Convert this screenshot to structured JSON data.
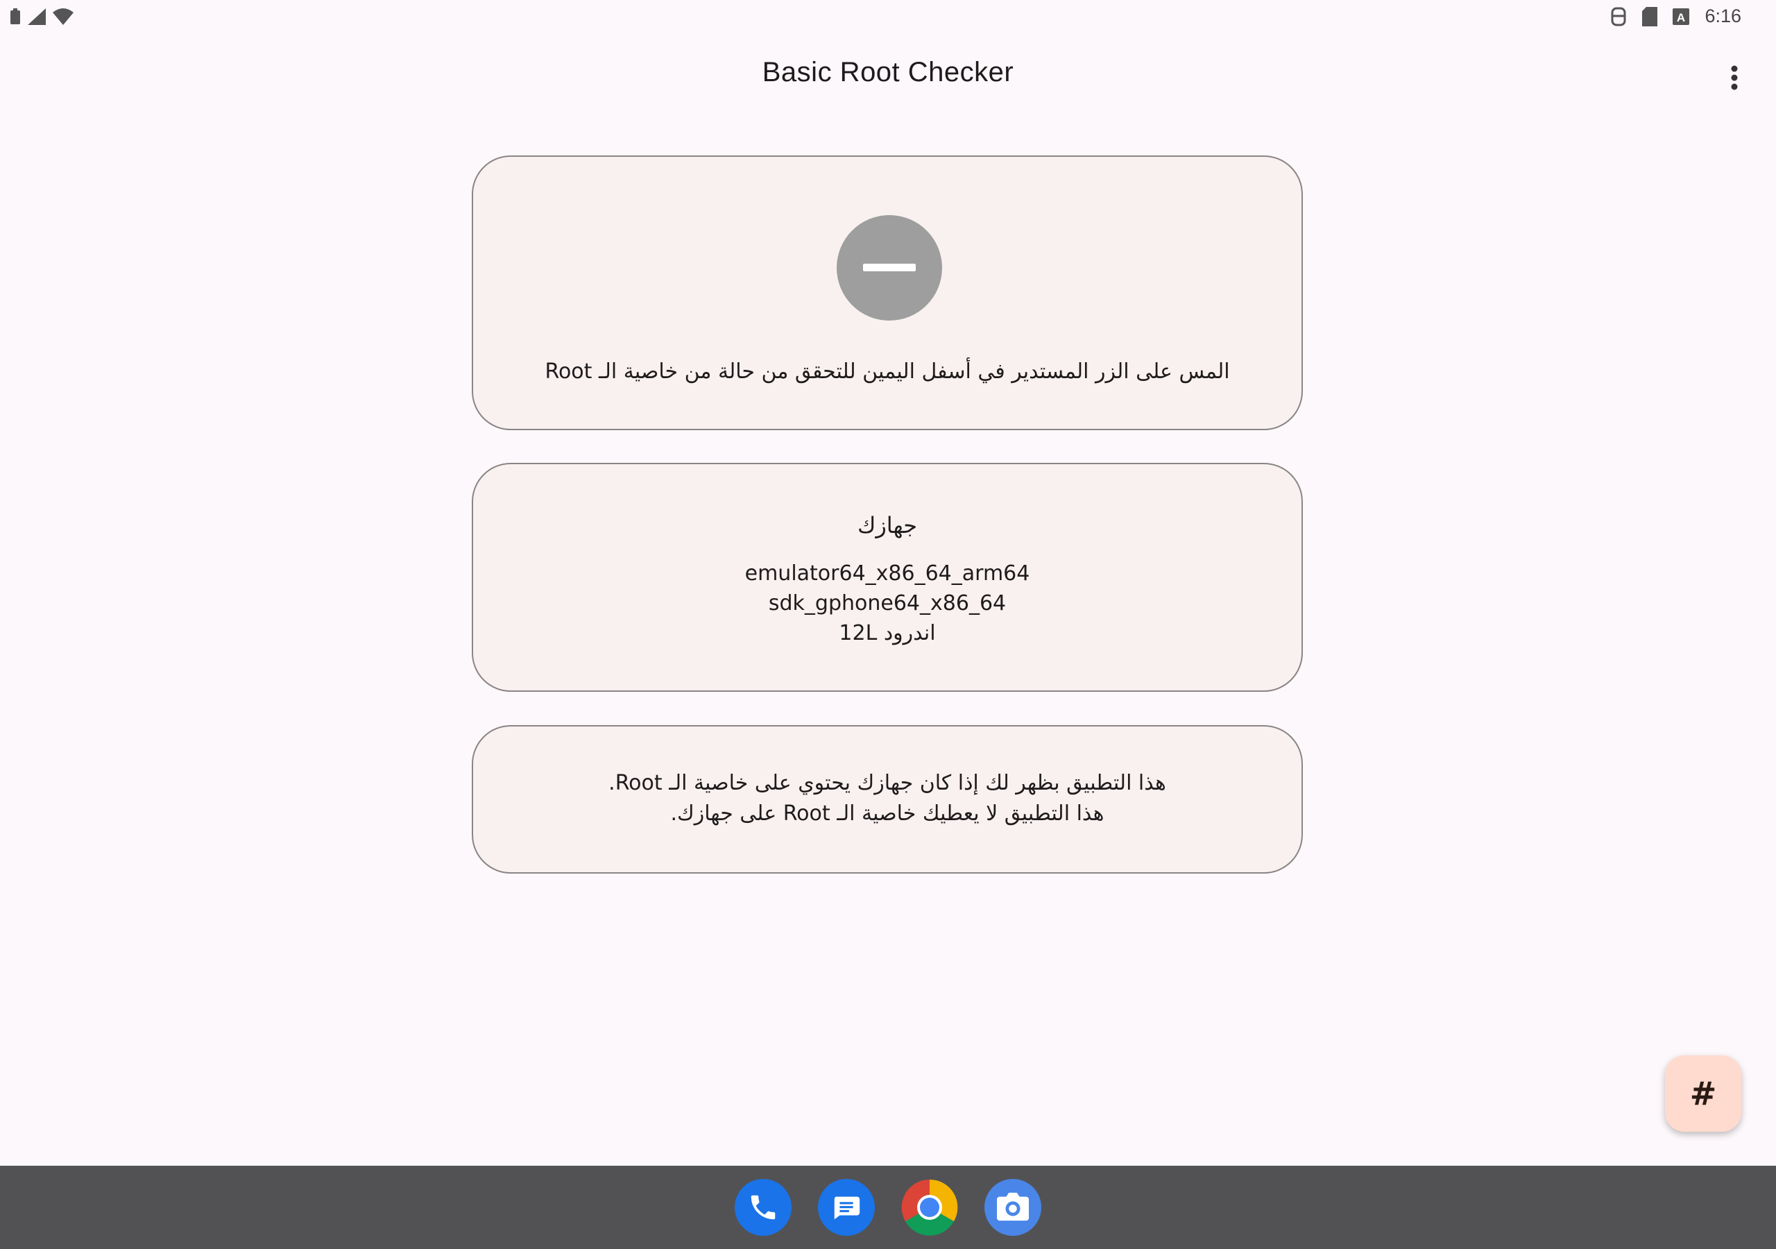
{
  "status_bar": {
    "time": "6:16",
    "icons": [
      "battery-icon",
      "signal-icon",
      "wifi-icon",
      "accessibility-icon",
      "sd-card-icon",
      "keyboard-a-icon"
    ]
  },
  "app_bar": {
    "title": "Basic Root Checker",
    "menu_icon": "more-vert-icon"
  },
  "status_card": {
    "status_icon": "minus-circle-icon",
    "message": "المس على الزر المستدير في أسفل اليمين للتحقق من حالة من خاصية الـ Root"
  },
  "device_card": {
    "title": "جهازك",
    "model": "emulator64_x86_64_arm64",
    "product": "sdk_gphone64_x86_64",
    "android_version": "اندرود 12L"
  },
  "info_card": {
    "line1": "هذا التطبيق بظهر لك إذا كان جهازك يحتوي على خاصية الـ Root.",
    "line2": "هذا التطبيق لا يعطيك خاصية الـ Root على جهازك."
  },
  "fab": {
    "label": "#"
  },
  "taskbar": {
    "apps": [
      "Phone",
      "Messages",
      "Chrome",
      "Camera"
    ]
  },
  "colors": {
    "background": "#fdf8fb",
    "card": "#f8f1f0",
    "status_circle": "#9e9e9e",
    "fab": "#ffdbcf",
    "taskbar": "#525255"
  }
}
